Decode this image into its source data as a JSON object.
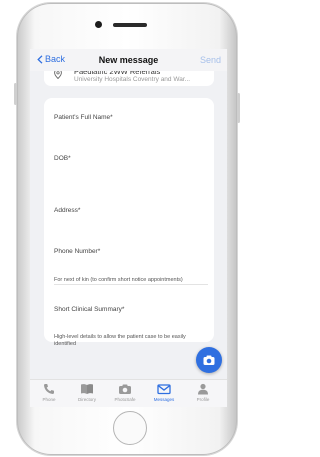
{
  "nav": {
    "back_label": "Back",
    "title": "New message",
    "send_label": "Send"
  },
  "referral": {
    "title": "Paediatric 2WW Referrals",
    "subtitle": "University Hospitals Coventry and War..."
  },
  "form": {
    "full_name_label": "Patient's Full Name*",
    "dob_label": "DOB*",
    "address_label": "Address*",
    "phone_label": "Phone Number*",
    "phone_note": "For next of kin (to confirm short notice appointments)",
    "summary_label": "Short Clinical Summary*",
    "summary_note": "High-level details to allow the patient case to be easily identified"
  },
  "tabs": [
    {
      "label": "Phone",
      "icon": "phone-icon",
      "active": false
    },
    {
      "label": "Directory",
      "icon": "book-icon",
      "active": false
    },
    {
      "label": "PhotoSafe",
      "icon": "camera-icon",
      "active": false
    },
    {
      "label": "Messages",
      "icon": "envelope-icon",
      "active": true
    },
    {
      "label": "Profile",
      "icon": "person-icon",
      "active": false
    }
  ],
  "colors": {
    "accent": "#2f6fe0",
    "send_disabled": "#a7c0ea",
    "background": "#f0f1f4"
  }
}
